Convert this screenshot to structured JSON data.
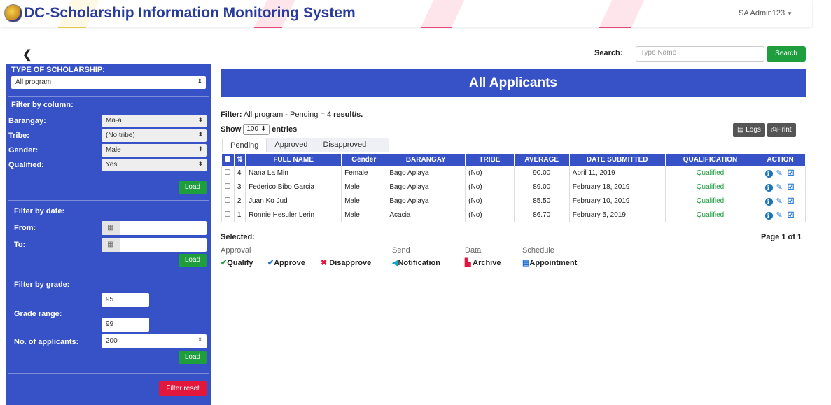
{
  "header": {
    "title": "DC-Scholarship Information Monitoring System",
    "user": "SA Admin123"
  },
  "search": {
    "label": "Search:",
    "placeholder": "Type Name",
    "button": "Search"
  },
  "sidebar": {
    "type_heading": "TYPE OF SCHOLARSHIP:",
    "type_value": "All program",
    "filter_column_heading": "Filter by column:",
    "barangay_label": "Barangay:",
    "barangay_value": "Ma-a",
    "tribe_label": "Tribe:",
    "tribe_value": "(No tribe)",
    "gender_label": "Gender:",
    "gender_value": "Male",
    "qualified_label": "Qualified:",
    "qualified_value": "Yes",
    "load_label": "Load",
    "filter_date_heading": "Filter by date:",
    "from_label": "From:",
    "to_label": "To:",
    "filter_grade_heading": "Filter by grade:",
    "grade_range_label": "Grade range:",
    "grade_from": "95",
    "grade_dash": "-",
    "grade_to": "99",
    "applicants_label": "No. of applicants:",
    "applicants_value": "200",
    "filter_reset": "Filter reset"
  },
  "main": {
    "title": "All Applicants",
    "filter_prefix": "Filter:",
    "filter_text": " All program - Pending = ",
    "filter_result": "4 result/s.",
    "show_label": "Show",
    "show_value": "100",
    "entries_label": "entries",
    "logs_label": "Logs",
    "print_label": "Print",
    "tabs": [
      "Pending",
      "Approved",
      "Disapproved"
    ],
    "columns": [
      "FULL NAME",
      "Gender",
      "BARANGAY",
      "TRIBE",
      "AVERAGE",
      "DATE SUBMITTED",
      "QUALIFICATION",
      "ACTION"
    ],
    "rows": [
      {
        "num": "4",
        "name": "Nana La Min",
        "gender": "Female",
        "barangay": "Bago Aplaya",
        "tribe": "(No)",
        "average": "90.00",
        "date": "April 11, 2019",
        "qual": "Qualified"
      },
      {
        "num": "3",
        "name": "Federico Bibo Garcia",
        "gender": "Male",
        "barangay": "Bago Aplaya",
        "tribe": "(No)",
        "average": "89.00",
        "date": "February 18, 2019",
        "qual": "Qualified"
      },
      {
        "num": "2",
        "name": "Juan Ko Jud",
        "gender": "Male",
        "barangay": "Bago Aplaya",
        "tribe": "(No)",
        "average": "85.50",
        "date": "February 10, 2019",
        "qual": "Qualified"
      },
      {
        "num": "1",
        "name": "Ronnie Hesuler Lerin",
        "gender": "Male",
        "barangay": "Acacia",
        "tribe": "(No)",
        "average": "86.70",
        "date": "February 5, 2019",
        "qual": "Qualified"
      }
    ],
    "selected_label": "Selected:",
    "page_label": "Page 1 of 1",
    "groups": {
      "approval": "Approval",
      "send": "Send",
      "data": "Data",
      "schedule": "Schedule"
    },
    "actions": {
      "qualify": "Qualify",
      "approve": "Approve",
      "disapprove": "Disapprove",
      "notification": "Notification",
      "archive": "Archive",
      "appointment": "Appointment"
    }
  },
  "colors": {
    "primary": "#3752c7",
    "success": "#1e9e3d",
    "danger": "#e3163c",
    "stripe": "#f03c6e"
  }
}
